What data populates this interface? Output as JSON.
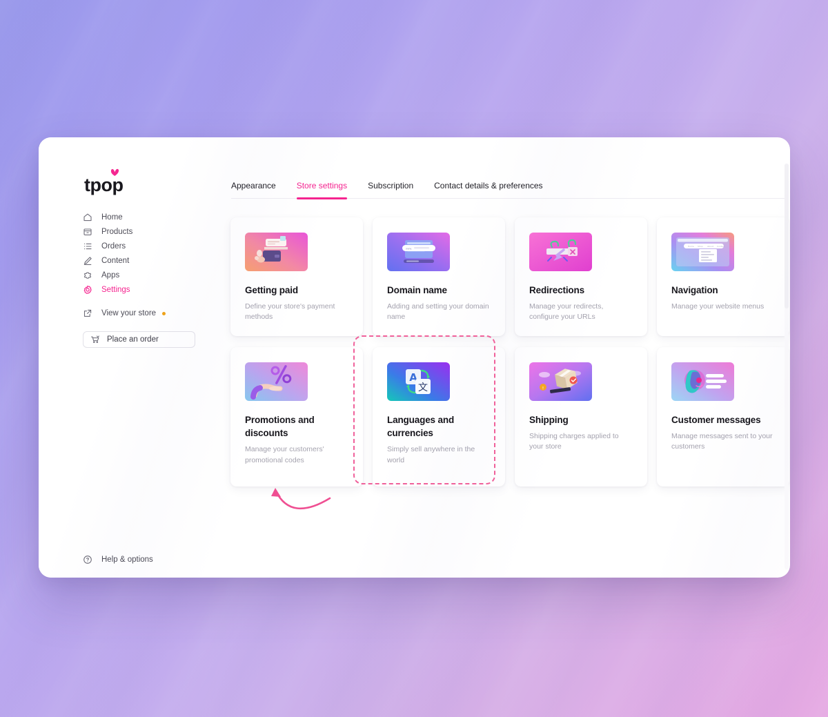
{
  "window": {
    "traffic_lights": [
      "close",
      "minimize",
      "maximize"
    ],
    "colors": {
      "red": "#e8756b",
      "yellow": "#edc352",
      "green": "#4fb83f"
    }
  },
  "brand": {
    "logo_text": "tpop",
    "accent": "#f5238f"
  },
  "sidebar": {
    "items": [
      {
        "label": "Home",
        "icon": "home-icon",
        "active": false
      },
      {
        "label": "Products",
        "icon": "products-icon",
        "active": false
      },
      {
        "label": "Orders",
        "icon": "orders-icon",
        "active": false
      },
      {
        "label": "Content",
        "icon": "content-icon",
        "active": false
      },
      {
        "label": "Apps",
        "icon": "apps-icon",
        "active": false
      },
      {
        "label": "Settings",
        "icon": "settings-icon",
        "active": true
      }
    ],
    "view_store": {
      "label": "View your store",
      "icon": "external-link-icon",
      "badge_color": "#f0a318"
    },
    "place_order": {
      "label": "Place an order",
      "icon": "cart-icon"
    },
    "help": {
      "label": "Help & options",
      "icon": "question-circle-icon"
    }
  },
  "tabs": [
    {
      "label": "Appearance",
      "active": false
    },
    {
      "label": "Store settings",
      "active": true
    },
    {
      "label": "Subscription",
      "active": false
    },
    {
      "label": "Contact details & preferences",
      "active": false
    }
  ],
  "cards": [
    {
      "title": "Getting paid",
      "desc": "Define your store's payment methods",
      "thumb": "wallet-payment-thumb",
      "row": 1,
      "highlighted": false
    },
    {
      "title": "Domain name",
      "desc": "Adding and setting your domain name",
      "thumb": "domain-browser-thumb",
      "row": 1,
      "highlighted": false
    },
    {
      "title": "Redirections",
      "desc": "Manage your redirects, configure your URLs",
      "thumb": "redirect-link-thumb",
      "row": 1,
      "highlighted": false
    },
    {
      "title": "Navigation",
      "desc": "Manage your website menus",
      "thumb": "nav-menu-thumb",
      "row": 1,
      "highlighted": false
    },
    {
      "title": "Promotions and discounts",
      "desc": "Manage your customers' promotional codes",
      "thumb": "percent-hand-thumb",
      "row": 2,
      "highlighted": true
    },
    {
      "title": "Languages and currencies",
      "desc": "Simply sell anywhere in the world",
      "thumb": "translate-thumb",
      "row": 2,
      "highlighted": false
    },
    {
      "title": "Shipping",
      "desc": "Shipping charges applied to your store",
      "thumb": "shipping-box-thumb",
      "row": 2,
      "highlighted": false
    },
    {
      "title": "Customer messages",
      "desc": "Manage messages sent to your customers",
      "thumb": "messages-face-thumb",
      "row": 2,
      "highlighted": false
    }
  ],
  "annotation": {
    "highlight_color": "#f0609a",
    "arrow": "curved-arrow-pointing-up-left",
    "target_card": "Promotions and discounts"
  }
}
